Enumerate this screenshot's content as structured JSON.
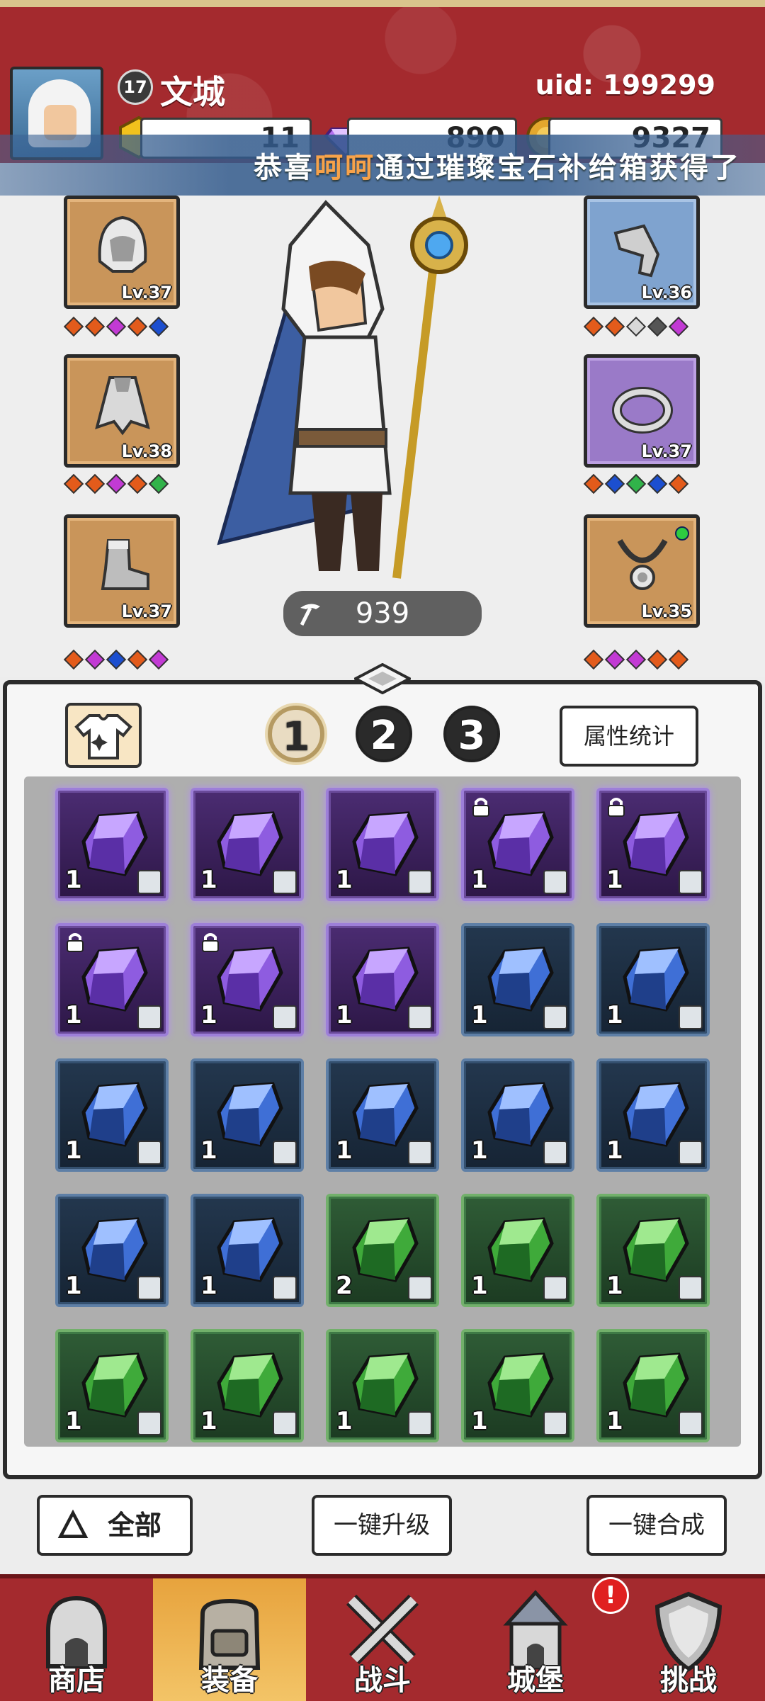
{
  "player": {
    "name": "文城",
    "level": "17",
    "uid": "uid: 199299"
  },
  "resources": {
    "gold": "11",
    "gems": "890",
    "coins": "9327"
  },
  "ticker": {
    "prefix": "恭喜",
    "highlight": "呵呵",
    "suffix": "通过璀璨宝石补给箱获得了"
  },
  "equipment": {
    "left": [
      {
        "name": "hood",
        "level": "Lv.37",
        "diamonds": [
          "#e35b1b",
          "#e35b1b",
          "#c23ad4",
          "#e35b1b",
          "#1c4fd0"
        ]
      },
      {
        "name": "cloak",
        "level": "Lv.38",
        "diamonds": [
          "#e35b1b",
          "#e35b1b",
          "#c23ad4",
          "#e35b1b",
          "#31b34a"
        ]
      },
      {
        "name": "boots",
        "level": "Lv.37",
        "diamonds": [
          "#e35b1b",
          "#c23ad4",
          "#1c4fd0",
          "#e35b1b",
          "#c23ad4"
        ]
      }
    ],
    "right": [
      {
        "name": "bracer",
        "level": "Lv.36",
        "diamonds": [
          "#e35b1b",
          "#e35b1b",
          "#d8d8d8",
          "#555555",
          "#c23ad4"
        ]
      },
      {
        "name": "ring",
        "level": "Lv.37",
        "diamonds": [
          "#e35b1b",
          "#1c4fd0",
          "#31b34a",
          "#1c4fd0",
          "#e35b1b"
        ]
      },
      {
        "name": "necklace",
        "level": "Lv.35",
        "diamonds": [
          "#e35b1b",
          "#c23ad4",
          "#c23ad4",
          "#e35b1b",
          "#e35b1b"
        ]
      }
    ],
    "power": "939"
  },
  "inventory": {
    "pages": [
      "1",
      "2",
      "3"
    ],
    "active_page": "1",
    "stats_label": "属性统计",
    "items": [
      {
        "color": "purple",
        "count": "1",
        "locked": false
      },
      {
        "color": "purple",
        "count": "1",
        "locked": false
      },
      {
        "color": "purple",
        "count": "1",
        "locked": false
      },
      {
        "color": "purple",
        "count": "1",
        "locked": true
      },
      {
        "color": "purple",
        "count": "1",
        "locked": true
      },
      {
        "color": "purple",
        "count": "1",
        "locked": true
      },
      {
        "color": "purple",
        "count": "1",
        "locked": true
      },
      {
        "color": "purple",
        "count": "1",
        "locked": false
      },
      {
        "color": "blue",
        "count": "1",
        "locked": false
      },
      {
        "color": "blue",
        "count": "1",
        "locked": false
      },
      {
        "color": "blue",
        "count": "1",
        "locked": false
      },
      {
        "color": "blue",
        "count": "1",
        "locked": false
      },
      {
        "color": "blue",
        "count": "1",
        "locked": false
      },
      {
        "color": "blue",
        "count": "1",
        "locked": false
      },
      {
        "color": "blue",
        "count": "1",
        "locked": false
      },
      {
        "color": "blue",
        "count": "1",
        "locked": false
      },
      {
        "color": "blue",
        "count": "1",
        "locked": false
      },
      {
        "color": "green",
        "count": "2",
        "locked": false
      },
      {
        "color": "green",
        "count": "1",
        "locked": false
      },
      {
        "color": "green",
        "count": "1",
        "locked": false
      },
      {
        "color": "green",
        "count": "1",
        "locked": false
      },
      {
        "color": "green",
        "count": "1",
        "locked": false
      },
      {
        "color": "green",
        "count": "1",
        "locked": false
      },
      {
        "color": "green",
        "count": "1",
        "locked": false
      },
      {
        "color": "green",
        "count": "1",
        "locked": false
      }
    ]
  },
  "actions": {
    "filter_label": "全部",
    "upgrade_label": "一键升级",
    "merge_label": "一键合成"
  },
  "nav": {
    "items": [
      {
        "label": "商店",
        "icon": "shop-icon"
      },
      {
        "label": "装备",
        "icon": "backpack-icon"
      },
      {
        "label": "战斗",
        "icon": "crossed-swords-icon"
      },
      {
        "label": "城堡",
        "icon": "castle-icon"
      },
      {
        "label": "挑战",
        "icon": "shield-icon"
      }
    ],
    "active": "装备",
    "alert": "!"
  },
  "colors": {
    "header_red": "#a42a2e",
    "gem_purple": "#9d7fd8",
    "gem_blue": "#5e7fa6",
    "gem_green": "#72b06b"
  }
}
